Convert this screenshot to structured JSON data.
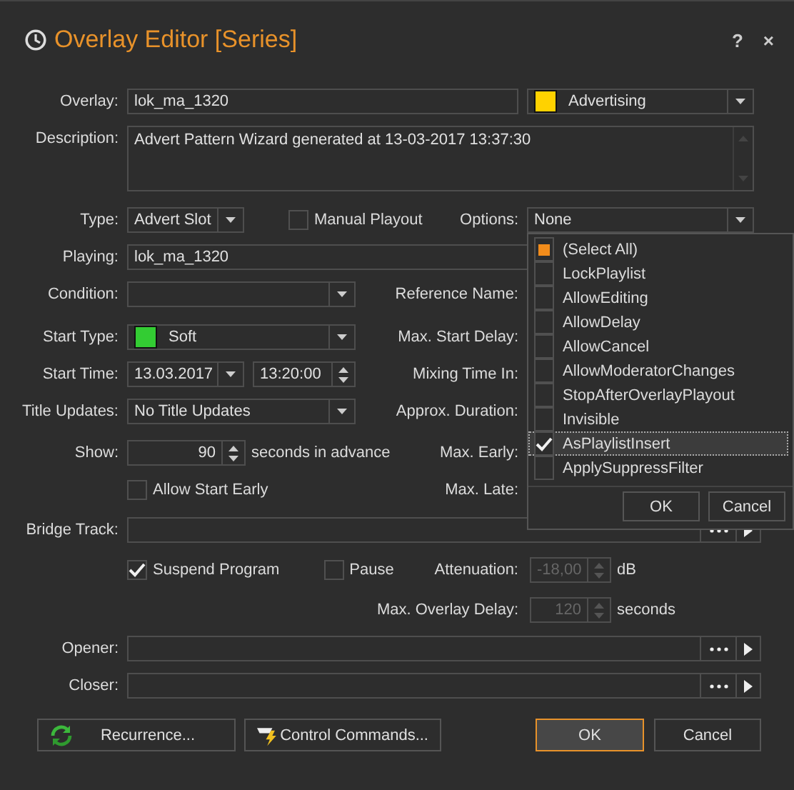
{
  "window": {
    "title": "Overlay Editor [Series]",
    "help": "?",
    "close": "×"
  },
  "overlay": {
    "label": "Overlay:",
    "value": "lok_ma_1320",
    "category": {
      "value": "Advertising",
      "color": "#ffd200"
    }
  },
  "description": {
    "label": "Description:",
    "value": "Advert Pattern Wizard generated at 13-03-2017 13:37:30"
  },
  "type": {
    "label": "Type:",
    "value": "Advert Slot"
  },
  "manual_playout": {
    "label": "Manual Playout",
    "checked": false
  },
  "options": {
    "label": "Options:",
    "value": "None",
    "expanded": true,
    "select_all": {
      "label": "(Select All)",
      "indeterminate": true
    },
    "items": [
      {
        "label": "LockPlaylist",
        "checked": false,
        "selected": false
      },
      {
        "label": "AllowEditing",
        "checked": false,
        "selected": false
      },
      {
        "label": "AllowDelay",
        "checked": false,
        "selected": false
      },
      {
        "label": "AllowCancel",
        "checked": false,
        "selected": false
      },
      {
        "label": "AllowModeratorChanges",
        "checked": false,
        "selected": false
      },
      {
        "label": "StopAfterOverlayPlayout",
        "checked": false,
        "selected": false
      },
      {
        "label": "Invisible",
        "checked": false,
        "selected": false
      },
      {
        "label": "AsPlaylistInsert",
        "checked": true,
        "selected": true
      },
      {
        "label": "ApplySuppressFilter",
        "checked": false,
        "selected": false
      }
    ],
    "buttons": [
      "OK",
      "Cancel"
    ]
  },
  "playing": {
    "label": "Playing:",
    "value": "lok_ma_1320"
  },
  "condition": {
    "label": "Condition:"
  },
  "reference_name": {
    "label": "Reference Name:"
  },
  "start_type": {
    "label": "Start Type:",
    "value": "Soft",
    "color": "#33cc33"
  },
  "max_start_delay": {
    "label": "Max. Start Delay:"
  },
  "start_time": {
    "label": "Start Time:",
    "date": "13.03.2017",
    "time": "13:20:00"
  },
  "mixing_time_in": {
    "label": "Mixing Time In:"
  },
  "title_updates": {
    "label": "Title Updates:",
    "value": "No Title Updates"
  },
  "approx_duration": {
    "label": "Approx. Duration:"
  },
  "show": {
    "label": "Show:",
    "value": "90",
    "suffix": "seconds in advance"
  },
  "max_early": {
    "label": "Max. Early:"
  },
  "allow_start_early": {
    "label": "Allow Start Early",
    "checked": false
  },
  "max_late": {
    "label": "Max. Late:"
  },
  "bridge_track": {
    "label": "Bridge Track:"
  },
  "suspend_program": {
    "label": "Suspend Program",
    "checked": true
  },
  "pause": {
    "label": "Pause",
    "checked": false
  },
  "attenuation": {
    "label": "Attenuation:",
    "value": "-18,00",
    "unit": "dB",
    "disabled": true
  },
  "max_overlay_delay": {
    "label": "Max. Overlay Delay:",
    "value": "120",
    "unit": "seconds",
    "disabled": true
  },
  "opener": {
    "label": "Opener:"
  },
  "closer": {
    "label": "Closer:"
  },
  "buttons": [
    {
      "label": "Recurrence...",
      "kind": "recurrence"
    },
    {
      "label": "Control Commands...",
      "kind": "commands"
    },
    {
      "label": "OK",
      "kind": "default"
    },
    {
      "label": "Cancel",
      "kind": "plain"
    }
  ]
}
